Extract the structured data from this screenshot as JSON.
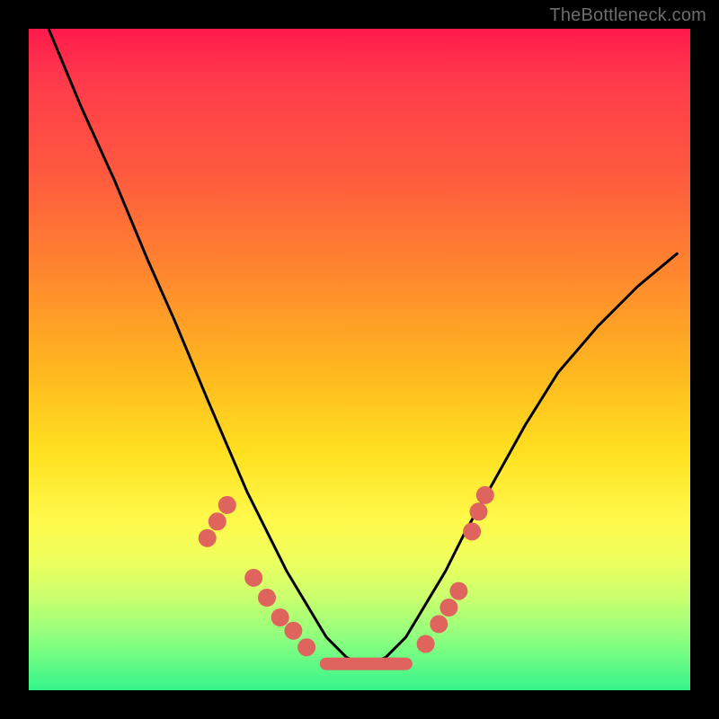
{
  "watermark": {
    "text": "TheBottleneck.com"
  },
  "chart_data": {
    "type": "line",
    "title": "",
    "xlabel": "",
    "ylabel": "",
    "xlim": [
      0,
      100
    ],
    "ylim": [
      0,
      100
    ],
    "series": [
      {
        "name": "curve",
        "x": [
          3,
          8,
          13,
          18,
          22,
          27,
          30,
          33,
          36,
          39,
          42,
          45,
          48,
          50,
          52,
          54,
          57,
          60,
          63,
          66,
          70,
          75,
          80,
          86,
          92,
          98
        ],
        "values": [
          100,
          88,
          77,
          65,
          56,
          44,
          37,
          30,
          24,
          18,
          13,
          8,
          5,
          4,
          4,
          5,
          8,
          13,
          18,
          24,
          31,
          40,
          48,
          55,
          61,
          66
        ]
      }
    ],
    "markers": [
      {
        "name": "left-dot",
        "x": 27.0,
        "y": 23.0
      },
      {
        "name": "left-dot",
        "x": 28.5,
        "y": 25.5
      },
      {
        "name": "left-dot",
        "x": 30.0,
        "y": 28.0
      },
      {
        "name": "left-dot",
        "x": 34.0,
        "y": 17.0
      },
      {
        "name": "left-dot",
        "x": 36.0,
        "y": 14.0
      },
      {
        "name": "left-dot",
        "x": 38.0,
        "y": 11.0
      },
      {
        "name": "left-dot",
        "x": 40.0,
        "y": 9.0
      },
      {
        "name": "left-dot",
        "x": 42.0,
        "y": 6.5
      },
      {
        "name": "right-dot",
        "x": 60.0,
        "y": 7.0
      },
      {
        "name": "right-dot",
        "x": 62.0,
        "y": 10.0
      },
      {
        "name": "right-dot",
        "x": 63.5,
        "y": 12.5
      },
      {
        "name": "right-dot",
        "x": 65.0,
        "y": 15.0
      },
      {
        "name": "right-dot",
        "x": 67.0,
        "y": 24.0
      },
      {
        "name": "right-dot",
        "x": 68.0,
        "y": 27.0
      },
      {
        "name": "right-dot",
        "x": 69.0,
        "y": 29.5
      }
    ],
    "bottom_bar": {
      "y": 4.0,
      "x_start": 44,
      "x_end": 58,
      "color": "#e0645e"
    },
    "colors": {
      "curve": "#000000",
      "marker": "#e0645e",
      "bg_top": "#ff1a4d",
      "bg_bottom": "#35f48b",
      "frame": "#000000"
    }
  }
}
